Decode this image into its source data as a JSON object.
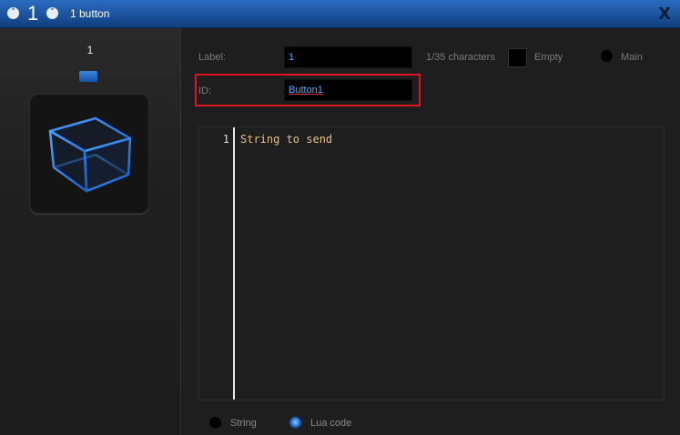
{
  "titlebar": {
    "up_glyph": "˄",
    "down_glyph": "˅",
    "number": "1",
    "title": "1 button",
    "close_label": "X"
  },
  "left_panel": {
    "button_number": "1",
    "led_color": "#2b73d1",
    "preview_icon": "cube-icon"
  },
  "form": {
    "label_caption": "Label:",
    "label_value": "1",
    "char_count": "1/35 characters",
    "empty_label": "Empty",
    "main_label": "Main",
    "id_caption": "ID:",
    "id_value": "Button1"
  },
  "editor": {
    "lines": [
      {
        "number": "1",
        "text": "String to send"
      }
    ]
  },
  "mode": {
    "string_label": "String",
    "lua_label": "Lua code",
    "selected": "Lua code"
  },
  "colors": {
    "title_bar": "#1a55a4",
    "highlight": "#e0141e",
    "code_text": "#e8c07a",
    "field_text": "#5aa6ff"
  }
}
